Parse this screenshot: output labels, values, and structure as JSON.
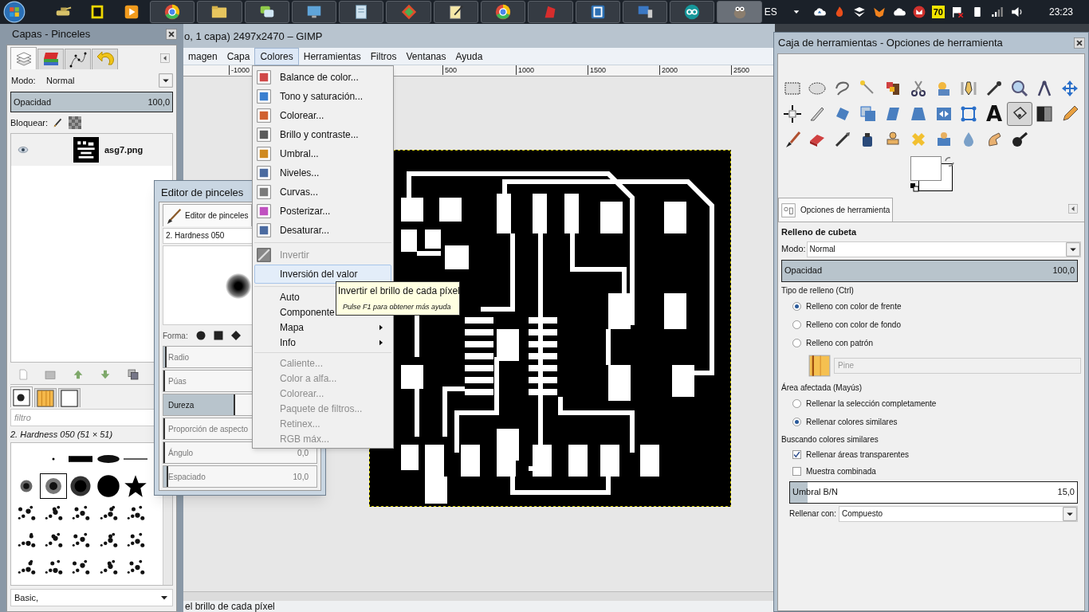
{
  "taskbar": {
    "language": "ES",
    "badge": "70",
    "clock": "23:23"
  },
  "gimp_window": {
    "title": "o, 1 capa) 2497x2470 – GIMP",
    "menu": [
      {
        "label": "magen",
        "selected": false
      },
      {
        "label": "Capa",
        "selected": false
      },
      {
        "label": "Colores",
        "selected": true
      },
      {
        "label": "Herramientas",
        "selected": false
      },
      {
        "label": "Filtros",
        "selected": false
      },
      {
        "label": "Ventanas",
        "selected": false
      },
      {
        "label": "Ayuda",
        "selected": false
      }
    ],
    "ruler_labels": [
      "-1000",
      "500",
      "1000",
      "1500",
      "2000",
      "2500"
    ],
    "status_text": "el brillo de cada píxel"
  },
  "layers_dock": {
    "title": "Capas - Pinceles",
    "tabs": [
      {
        "selected": true
      },
      {
        "selected": false
      },
      {
        "selected": false
      },
      {
        "selected": false
      }
    ],
    "mode_label": "Modo:",
    "mode": "Normal",
    "opacity": {
      "label": "Opacidad",
      "value": "100,0",
      "level": 1
    },
    "lock_label": "Bloquear:",
    "layers": [
      {
        "name": "asg7.png",
        "visible": true
      }
    ],
    "brush_tabs": [
      {
        "selected": true
      },
      {
        "selected": false
      },
      {
        "selected": false
      }
    ],
    "filter_placeholder": "filtro",
    "brush_name": "2. Hardness 050 (51 × 51)",
    "brushes": [
      {
        "selected": false
      },
      {
        "selected": false
      },
      {
        "selected": false
      },
      {
        "selected": false
      },
      {
        "selected": false
      },
      {
        "selected": true
      },
      {
        "selected": false
      },
      {
        "selected": false
      },
      {
        "selected": false
      },
      {
        "selected": false
      },
      {
        "selected": false
      },
      {
        "selected": false
      },
      {
        "selected": false
      },
      {
        "selected": false
      },
      {
        "selected": false
      },
      {
        "selected": false
      },
      {
        "selected": false
      },
      {
        "selected": false
      },
      {
        "selected": false
      },
      {
        "selected": false
      },
      {
        "selected": false
      },
      {
        "selected": false
      },
      {
        "selected": false
      },
      {
        "selected": false
      }
    ],
    "tag": "Basic,"
  },
  "brush_editor": {
    "title": "Editor de pinceles",
    "tab": "Editor de pinceles",
    "name": "2. Hardness 050",
    "shape_label": "Forma:",
    "sliders": [
      {
        "label": "Radio",
        "level": 0.02
      },
      {
        "label": "Púas",
        "level": 0
      },
      {
        "label": "Dureza",
        "level": 0.47
      },
      {
        "label": "Proporción de aspecto",
        "level": 0
      },
      {
        "label": "Ángulo",
        "value": "0,0",
        "level": 0
      },
      {
        "label": "Espaciado",
        "value": "10,0",
        "level": 0.03
      }
    ]
  },
  "colors_menu": {
    "items": [
      {
        "kind": "item",
        "label": "Balance de color...",
        "disabled": false,
        "selected": false
      },
      {
        "kind": "item",
        "label": "Tono y saturación...",
        "disabled": false,
        "selected": false
      },
      {
        "kind": "item",
        "label": "Colorear...",
        "disabled": false,
        "selected": false
      },
      {
        "kind": "item",
        "label": "Brillo y contraste...",
        "disabled": false,
        "selected": false
      },
      {
        "kind": "item",
        "label": "Umbral...",
        "disabled": false,
        "selected": false
      },
      {
        "kind": "item",
        "label": "Niveles...",
        "disabled": false,
        "selected": false
      },
      {
        "kind": "item",
        "label": "Curvas...",
        "disabled": false,
        "selected": false
      },
      {
        "kind": "item",
        "label": "Posterizar...",
        "disabled": false,
        "selected": false
      },
      {
        "kind": "item",
        "label": "Desaturar...",
        "disabled": false,
        "selected": false
      },
      {
        "kind": "separator"
      },
      {
        "kind": "item",
        "label": "Invertir",
        "disabled": true,
        "selected": false
      },
      {
        "kind": "item",
        "label": "Inversión del valor",
        "disabled": false,
        "selected": true
      },
      {
        "kind": "separator"
      },
      {
        "kind": "item",
        "label": "Auto",
        "disabled": false,
        "selected": false
      },
      {
        "kind": "item",
        "label": "Componente",
        "disabled": false,
        "selected": false
      },
      {
        "kind": "submenu",
        "label": "Mapa",
        "disabled": false,
        "selected": false
      },
      {
        "kind": "submenu",
        "label": "Info",
        "disabled": false,
        "selected": false
      },
      {
        "kind": "separator"
      },
      {
        "kind": "item",
        "label": "Caliente...",
        "disabled": true,
        "selected": false
      },
      {
        "kind": "item",
        "label": "Color a alfa...",
        "disabled": true,
        "selected": false
      },
      {
        "kind": "item",
        "label": "Colorear...",
        "disabled": true,
        "selected": false
      },
      {
        "kind": "item",
        "label": "Paquete de filtros...",
        "disabled": true,
        "selected": false
      },
      {
        "kind": "item",
        "label": "Retinex...",
        "disabled": true,
        "selected": false
      },
      {
        "kind": "item",
        "label": "RGB máx...",
        "disabled": true,
        "selected": false
      }
    ]
  },
  "tooltip": {
    "text": "Invertir el brillo de cada píxel",
    "hint": "Pulse F1 para obtener más ayuda"
  },
  "toolbox": {
    "title": "Caja de herramientas - Opciones de herramienta",
    "text_tool_glyph": "A",
    "tools": [
      {
        "selected": false
      },
      {
        "selected": false
      },
      {
        "selected": false
      },
      {
        "selected": false
      },
      {
        "selected": false
      },
      {
        "selected": false
      },
      {
        "selected": false
      },
      {
        "selected": false
      },
      {
        "selected": false
      },
      {
        "selected": false
      },
      {
        "selected": false
      },
      {
        "selected": false
      },
      {
        "selected": false
      },
      {
        "selected": false
      },
      {
        "selected": false
      },
      {
        "selected": false
      },
      {
        "selected": false
      },
      {
        "selected": false
      },
      {
        "selected": false
      },
      {
        "selected": false
      },
      {
        "selected": false
      },
      {
        "selected": true
      },
      {
        "selected": false
      },
      {
        "selected": false
      },
      {
        "selected": false
      },
      {
        "selected": false
      },
      {
        "selected": false
      },
      {
        "selected": false
      },
      {
        "selected": false
      },
      {
        "selected": false
      },
      {
        "selected": false
      },
      {
        "selected": false
      },
      {
        "selected": false
      },
      {
        "selected": false
      }
    ],
    "options_tab": "Opciones de herramienta",
    "tool_name": "Relleno de cubeta",
    "mode_label": "Modo:",
    "mode": "Normal",
    "opacity": {
      "label": "Opacidad",
      "value": "100,0",
      "level": 1
    },
    "fill_type_label": "Tipo de relleno  (Ctrl)",
    "fill_types": [
      {
        "label": "Relleno con color de frente",
        "selected": true
      },
      {
        "label": "Relleno con color de fondo",
        "selected": false
      },
      {
        "label": "Relleno con patrón",
        "selected": false
      }
    ],
    "pattern": "Pine",
    "area_label": "Área afectada  (Mayús)",
    "areas": [
      {
        "label": "Rellenar la selección completamente",
        "selected": false
      },
      {
        "label": "Rellenar colores similares",
        "selected": true
      }
    ],
    "similar_label": "Buscando colores similares",
    "checks": [
      {
        "label": "Rellenar áreas transparentes",
        "checked": true
      },
      {
        "label": "Muestra combinada",
        "checked": false
      }
    ],
    "threshold": {
      "label": "Umbral B/N",
      "value": "15,0",
      "level": 0.06
    },
    "fill_with_label": "Rellenar con:",
    "fill_with": "Compuesto"
  }
}
